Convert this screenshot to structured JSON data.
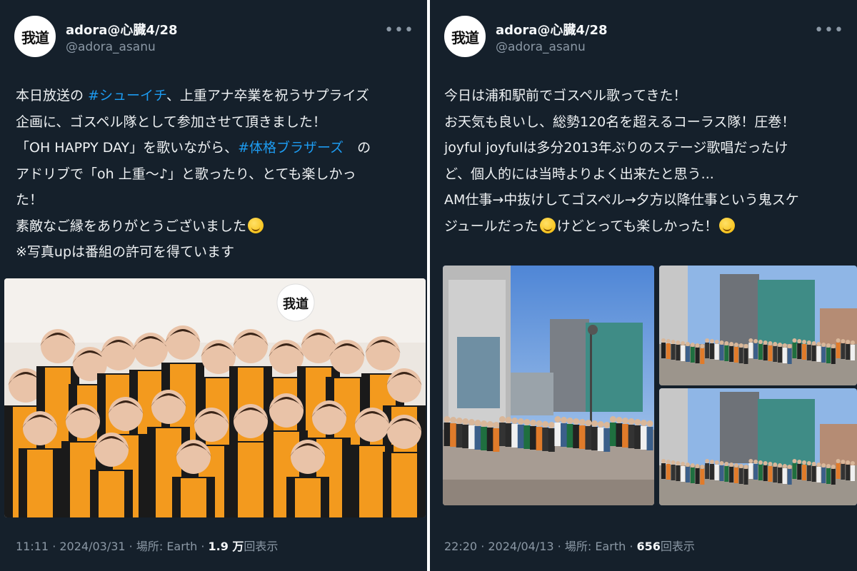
{
  "posts": [
    {
      "display_name": "adora@心臓4/28",
      "handle": "@adora_asanu",
      "avatar_text": "我道",
      "more": "•••",
      "lines": [
        [
          {
            "t": "本日放送の "
          },
          {
            "t": "#シューイチ",
            "tag": true
          },
          {
            "t": "、上重アナ卒業を祝うサプライズ"
          }
        ],
        [
          {
            "t": "企画に、ゴスペル隊として参加させて頂きました！"
          }
        ],
        [
          {
            "t": "「OH HAPPY DAY」を歌いながら、"
          },
          {
            "t": "#体格ブラザーズ",
            "tag": true
          },
          {
            "t": "　の"
          }
        ],
        [
          {
            "t": "アドリブで「oh 上重〜♪」と歌ったり、とても楽しかっ"
          }
        ],
        [
          {
            "t": "た！"
          }
        ],
        [
          {
            "t": "素敵なご縁をありがとうございました"
          },
          {
            "emoji": "smile"
          }
        ],
        [
          {
            "t": "※写真upは番組の許可を得ています"
          }
        ]
      ],
      "photo_label": "我道",
      "time": "11:11 · 2024/03/31 · 場所: Earth · ",
      "views_count": "1.9 万",
      "views_label": "回表示"
    },
    {
      "display_name": "adora@心臓4/28",
      "handle": "@adora_asanu",
      "avatar_text": "我道",
      "more": "•••",
      "lines": [
        [
          {
            "t": "今日は浦和駅前でゴスペル歌ってきた！"
          }
        ],
        [
          {
            "t": "お天気も良いし、総勢120名を超えるコーラス隊！圧巻！"
          }
        ],
        [
          {
            "t": "joyful joyfulは多分2013年ぶりのステージ歌唱だったけ"
          }
        ],
        [
          {
            "t": "ど、個人的には当時よりよく出来たと思う..."
          }
        ],
        [
          {
            "t": "AM仕事→中抜けしてゴスペル→夕方以降仕事という鬼スケ"
          }
        ],
        [
          {
            "t": "ジュールだった"
          },
          {
            "emoji": "dizzy"
          },
          {
            "t": "けどとっても楽しかった！"
          },
          {
            "emoji": "laugh"
          }
        ]
      ],
      "time": "22:20 · 2024/04/13 · 場所: Earth · ",
      "views_count": "656",
      "views_label": "回表示"
    }
  ],
  "colors": {
    "background": "#15202b",
    "text": "#e7e9ea",
    "hashtag": "#1d9bf0",
    "muted": "#8b98a5",
    "stole": "#f39a1e"
  }
}
